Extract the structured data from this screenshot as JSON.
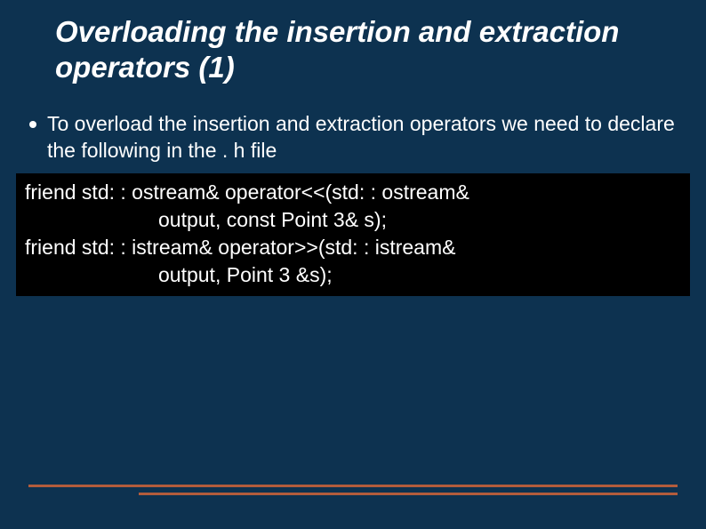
{
  "slide": {
    "title": "Overloading the insertion and extraction operators (1)",
    "bullets": [
      {
        "text": "To overload the insertion and extraction operators we need to declare the following in the . h file"
      }
    ],
    "code": {
      "lines": [
        {
          "text": "friend std: : ostream& operator<<(std: : ostream&",
          "indent": false
        },
        {
          "text": "output, const Point 3& s);",
          "indent": true
        },
        {
          "text": "friend std: : istream& operator>>(std: : istream&",
          "indent": false
        },
        {
          "text": "output, Point 3 &s);",
          "indent": true
        }
      ]
    }
  },
  "colors": {
    "background": "#0d3250",
    "code_bg": "#000000",
    "text": "#ffffff",
    "accent": "#b25c3c"
  }
}
